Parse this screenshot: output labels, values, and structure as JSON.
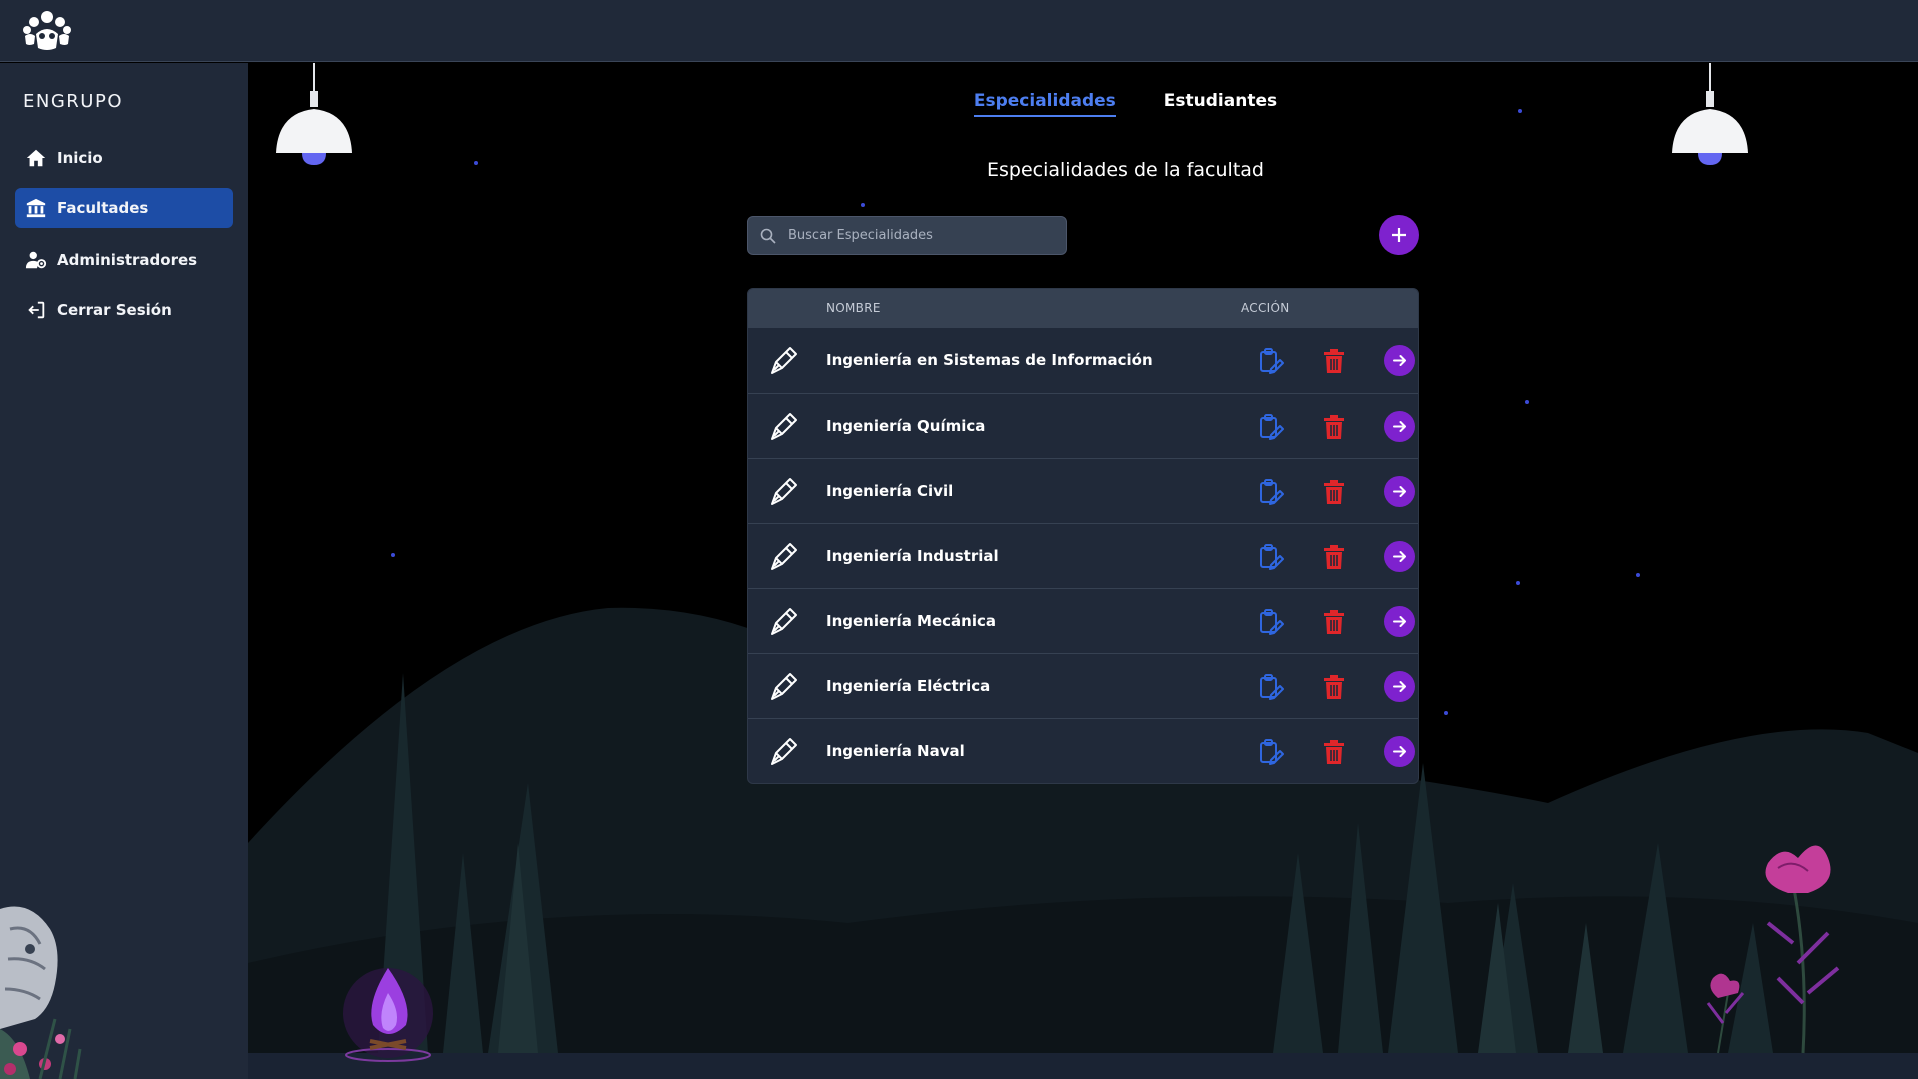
{
  "app": {
    "brand": "ENGRUPO"
  },
  "sidebar": {
    "items": [
      {
        "label": "Inicio",
        "icon": "home-icon",
        "active": false
      },
      {
        "label": "Facultades",
        "icon": "institution-icon",
        "active": true
      },
      {
        "label": "Administradores",
        "icon": "admin-users-icon",
        "active": false
      },
      {
        "label": "Cerrar Sesión",
        "icon": "logout-icon",
        "active": false
      }
    ]
  },
  "tabs": [
    {
      "label": "Especialidades",
      "active": true
    },
    {
      "label": "Estudiantes",
      "active": false
    }
  ],
  "main": {
    "title": "Especialidades de la facultad",
    "search_placeholder": "Buscar Especialidades",
    "table": {
      "columns": [
        "NOMBRE",
        "ACCIÓN"
      ],
      "rows": [
        {
          "name": "Ingeniería en Sistemas de Información"
        },
        {
          "name": "Ingeniería Química"
        },
        {
          "name": "Ingeniería Civil"
        },
        {
          "name": "Ingeniería Industrial"
        },
        {
          "name": "Ingeniería Mecánica"
        },
        {
          "name": "Ingeniería Eléctrica"
        },
        {
          "name": "Ingeniería Naval"
        }
      ]
    }
  },
  "colors": {
    "accent_blue": "#1d4da6",
    "tab_active": "#4d7ef0",
    "purple": "#7e22ce",
    "delete_red": "#e0262a",
    "edit_blue": "#2f66e0",
    "panel": "#202939"
  }
}
